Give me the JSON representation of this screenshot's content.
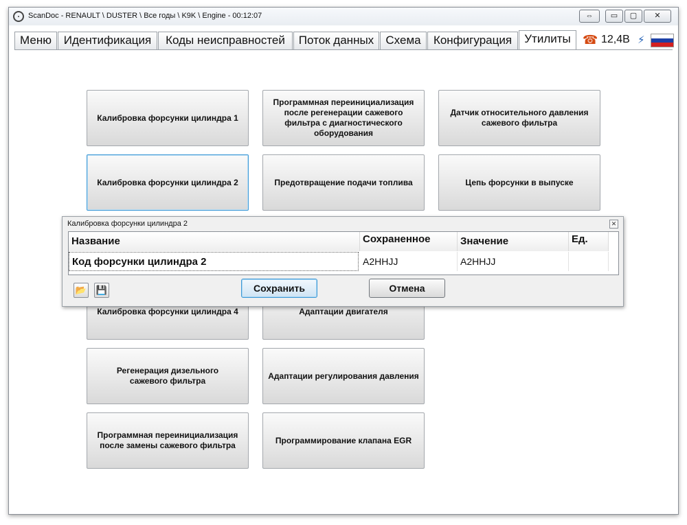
{
  "window": {
    "title": "ScanDoc - RENAULT \\ DUSTER \\ Все годы \\ K9K \\ Engine - 00:12:07",
    "controls": {
      "switch": "⇔",
      "minimize": "▭",
      "maximize": "▢",
      "close": "✕"
    }
  },
  "tabs": [
    {
      "label": "Меню"
    },
    {
      "label": "Идентификация"
    },
    {
      "label": "Коды неисправностей"
    },
    {
      "label": "Поток данных"
    },
    {
      "label": "Схема"
    },
    {
      "label": "Конфигурация"
    },
    {
      "label": "Утилиты",
      "active": true
    }
  ],
  "status": {
    "voltage": "12,4В",
    "phone_icon": "☎",
    "plug_icon": "⚡"
  },
  "functions": [
    {
      "label": "Калибровка форсунки цилиндра 1"
    },
    {
      "label": "Программная переинициализация после регенерации сажевого фильтра с диагностического оборудования"
    },
    {
      "label": "Датчик относительного давления сажевого фильтра"
    },
    {
      "label": "Калибровка форсунки цилиндра 2"
    },
    {
      "label": "Предотвращение подачи топлива"
    },
    {
      "label": "Цепь форсунки в выпуске"
    },
    {
      "label": "Калибровка форсунки цилиндра 4"
    },
    {
      "label": "Адаптации двигателя"
    },
    {
      "label": "Регенерация дизельного\nсажевого фильтра"
    },
    {
      "label": "Адаптации регулирования давления"
    },
    {
      "label": "Программная переинициализация после замены сажевого фильтра"
    },
    {
      "label": "Программирование клапана EGR"
    }
  ],
  "dialog": {
    "title": "Калибровка форсунки цилиндра 2",
    "close": "✕",
    "columns": {
      "name": "Название",
      "saved": "Сохраненное",
      "value": "Значение",
      "unit": "Ед."
    },
    "row": {
      "name": "Код форсунки цилиндра 2",
      "saved": "A2HHJJ",
      "value": "A2HHJJ",
      "unit": ""
    },
    "open_icon": "📂",
    "save_icon": "💾",
    "save_button": "Сохранить",
    "cancel_button": "Отмена"
  }
}
